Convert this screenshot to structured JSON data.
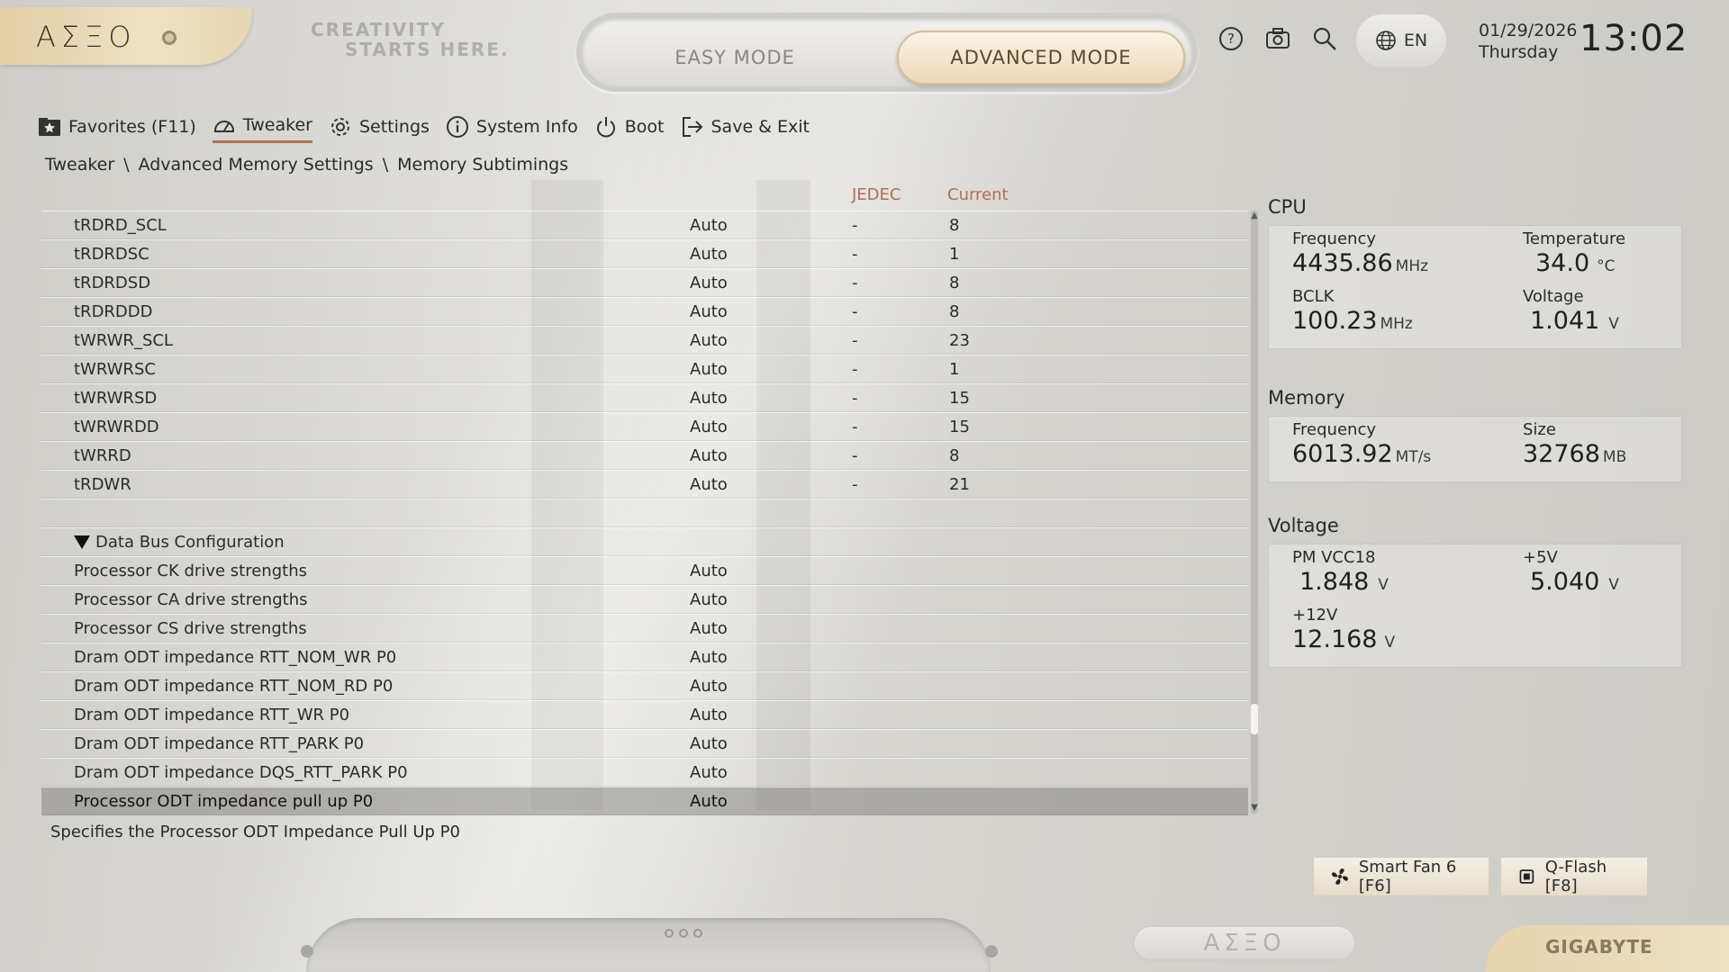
{
  "brand": {
    "logo": "ΑΣΞΟ",
    "tagline_line1": "CREATIVITY",
    "tagline_line2": "STARTS HERE.",
    "bottom_logo": "ΑΣΞΟ",
    "vendor": "GIGABYTE"
  },
  "modes": {
    "easy": "EASY MODE",
    "advanced": "ADVANCED MODE",
    "active": "advanced"
  },
  "header": {
    "icons": [
      "help-icon",
      "camera-icon",
      "search-icon"
    ],
    "language": "EN",
    "date": "01/29/2026",
    "weekday": "Thursday",
    "time": "13:02"
  },
  "nav": {
    "items": [
      {
        "label": "Favorites (F11)",
        "icon": "star-folder-icon"
      },
      {
        "label": "Tweaker",
        "icon": "speedometer-icon",
        "active": true
      },
      {
        "label": "Settings",
        "icon": "gear-icon"
      },
      {
        "label": "System Info",
        "icon": "info-icon"
      },
      {
        "label": "Boot",
        "icon": "power-icon"
      },
      {
        "label": "Save & Exit",
        "icon": "exit-icon"
      }
    ]
  },
  "breadcrumb": {
    "a": "Tweaker",
    "sep": "\\",
    "b": "Advanced Memory Settings",
    "c": "Memory Subtimings"
  },
  "table": {
    "headers": {
      "jedec": "JEDEC",
      "current": "Current"
    },
    "rows": [
      {
        "name": "tRDRD_SCL",
        "value": "Auto",
        "jedec": "-",
        "current": "8"
      },
      {
        "name": "tRDRDSC",
        "value": "Auto",
        "jedec": "-",
        "current": "1"
      },
      {
        "name": "tRDRDSD",
        "value": "Auto",
        "jedec": "-",
        "current": "8"
      },
      {
        "name": "tRDRDDD",
        "value": "Auto",
        "jedec": "-",
        "current": "8"
      },
      {
        "name": "tWRWR_SCL",
        "value": "Auto",
        "jedec": "-",
        "current": "23"
      },
      {
        "name": "tWRWRSC",
        "value": "Auto",
        "jedec": "-",
        "current": "1"
      },
      {
        "name": "tWRWRSD",
        "value": "Auto",
        "jedec": "-",
        "current": "15"
      },
      {
        "name": "tWRWRDD",
        "value": "Auto",
        "jedec": "-",
        "current": "15"
      },
      {
        "name": "tWRRD",
        "value": "Auto",
        "jedec": "-",
        "current": "8"
      },
      {
        "name": "tRDWR",
        "value": "Auto",
        "jedec": "-",
        "current": "21"
      }
    ],
    "section": "Data Bus Configuration",
    "section_rows": [
      {
        "name": "Processor CK drive strengths",
        "value": "Auto"
      },
      {
        "name": "Processor CA drive strengths",
        "value": "Auto"
      },
      {
        "name": "Processor CS drive strengths",
        "value": "Auto"
      },
      {
        "name": "Dram ODT impedance RTT_NOM_WR P0",
        "value": "Auto"
      },
      {
        "name": "Dram ODT impedance RTT_NOM_RD P0",
        "value": "Auto"
      },
      {
        "name": "Dram ODT impedance RTT_WR P0",
        "value": "Auto"
      },
      {
        "name": "Dram ODT impedance RTT_PARK P0",
        "value": "Auto"
      },
      {
        "name": "Dram ODT impedance DQS_RTT_PARK P0",
        "value": "Auto"
      },
      {
        "name": "Processor ODT impedance pull up P0",
        "value": "Auto",
        "selected": true
      }
    ]
  },
  "help_text": "Specifies the Processor ODT Impedance Pull Up P0",
  "cpu": {
    "title": "CPU",
    "freq_label": "Frequency",
    "freq": "4435.86",
    "freq_unit": "MHz",
    "temp_label": "Temperature",
    "temp": "34.0",
    "temp_unit": "°C",
    "bclk_label": "BCLK",
    "bclk": "100.23",
    "bclk_unit": "MHz",
    "volt_label": "Voltage",
    "volt": "1.041",
    "volt_unit": "V"
  },
  "memory": {
    "title": "Memory",
    "freq_label": "Frequency",
    "freq": "6013.92",
    "freq_unit": "MT/s",
    "size_label": "Size",
    "size": "32768",
    "size_unit": "MB"
  },
  "voltage": {
    "title": "Voltage",
    "vcc18_label": "PM VCC18",
    "vcc18": "1.848",
    "vcc18_unit": "V",
    "v5_label": "+5V",
    "v5": "5.040",
    "v5_unit": "V",
    "v12_label": "+12V",
    "v12": "12.168",
    "v12_unit": "V"
  },
  "buttons": {
    "smart_fan": "Smart Fan 6 [F6]",
    "qflash": "Q-Flash [F8]"
  },
  "colors": {
    "accent": "#b07256",
    "gold": "#e3cfa6",
    "selected_row": "#8e8c88"
  }
}
